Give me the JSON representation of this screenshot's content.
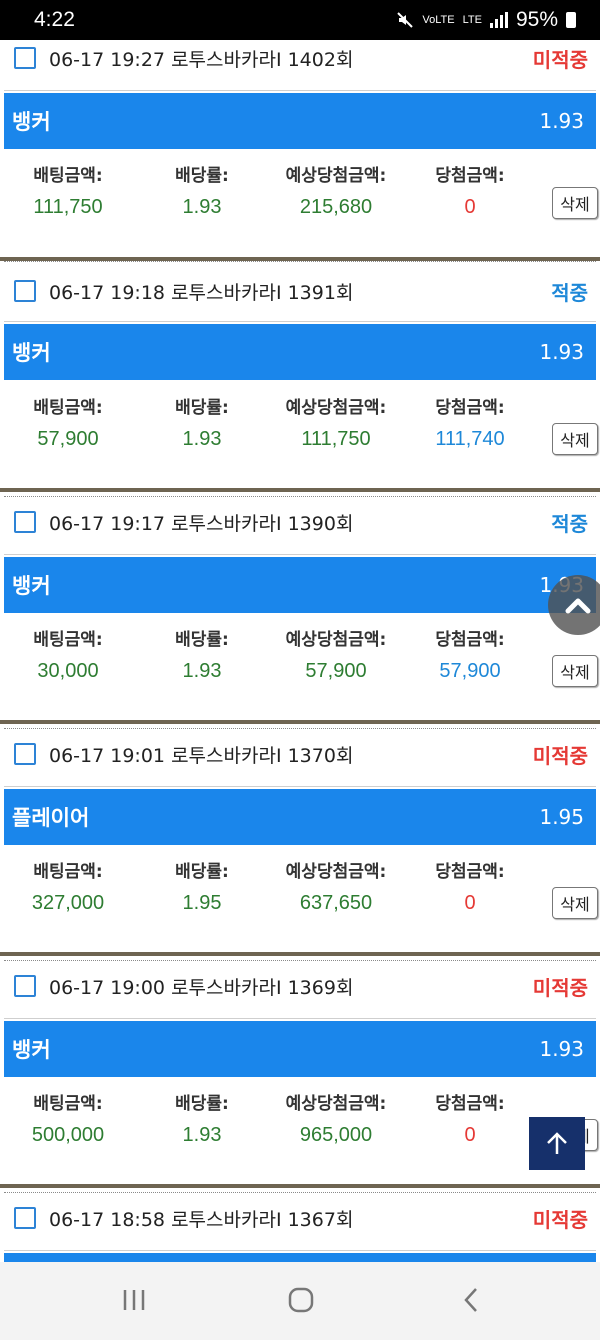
{
  "status_bar": {
    "time": "4:22",
    "network": "LTE",
    "volte": "VoLTE",
    "battery": "95%"
  },
  "labels": {
    "bet_amount": "배팅금액:",
    "odds_rate": "배당률:",
    "expected_win": "예상당첨금액:",
    "win_amount": "당첨금액:",
    "delete": "삭제"
  },
  "bets": [
    {
      "time": "06-17 19:27",
      "game": "로투스바카라I",
      "round": "1402회",
      "status": "미적중",
      "status_color": "#e53935",
      "pick": "뱅커",
      "odds": "1.93",
      "bet": "111,750",
      "rate": "1.93",
      "expected": "215,680",
      "win": "0",
      "win_color": "#e53935"
    },
    {
      "time": "06-17 19:18",
      "game": "로투스바카라I",
      "round": "1391회",
      "status": "적중",
      "status_color": "#1e88d8",
      "pick": "뱅커",
      "odds": "1.93",
      "bet": "57,900",
      "rate": "1.93",
      "expected": "111,750",
      "win": "111,740",
      "win_color": "#1e88d8"
    },
    {
      "time": "06-17 19:17",
      "game": "로투스바카라I",
      "round": "1390회",
      "status": "적중",
      "status_color": "#1e88d8",
      "pick": "뱅커",
      "odds": "1.93",
      "bet": "30,000",
      "rate": "1.93",
      "expected": "57,900",
      "win": "57,900",
      "win_color": "#1e88d8"
    },
    {
      "time": "06-17 19:01",
      "game": "로투스바카라I",
      "round": "1370회",
      "status": "미적중",
      "status_color": "#e53935",
      "pick": "플레이어",
      "odds": "1.95",
      "bet": "327,000",
      "rate": "1.95",
      "expected": "637,650",
      "win": "0",
      "win_color": "#e53935"
    },
    {
      "time": "06-17 19:00",
      "game": "로투스바카라I",
      "round": "1369회",
      "status": "미적중",
      "status_color": "#e53935",
      "pick": "뱅커",
      "odds": "1.93",
      "bet": "500,000",
      "rate": "1.93",
      "expected": "965,000",
      "win": "0",
      "win_color": "#e53935"
    },
    {
      "time": "06-17 18:58",
      "game": "로투스바카라I",
      "round": "1367회",
      "status": "미적중",
      "status_color": "#e53935",
      "pick": "",
      "odds": "",
      "bet": "",
      "rate": "",
      "expected": "",
      "win": "",
      "win_color": "#e53935"
    }
  ],
  "icons": {
    "scroll_up": "chevron-up-icon",
    "back_to_top": "arrow-up-icon",
    "nav_recents": "recents-icon",
    "nav_home": "home-icon",
    "nav_back": "back-icon"
  },
  "colors": {
    "accent_blue": "#1a86eb",
    "win_red": "#e53935",
    "win_blue": "#1e88d8",
    "value_green": "#2e7d32",
    "top_button": "#16306b"
  }
}
